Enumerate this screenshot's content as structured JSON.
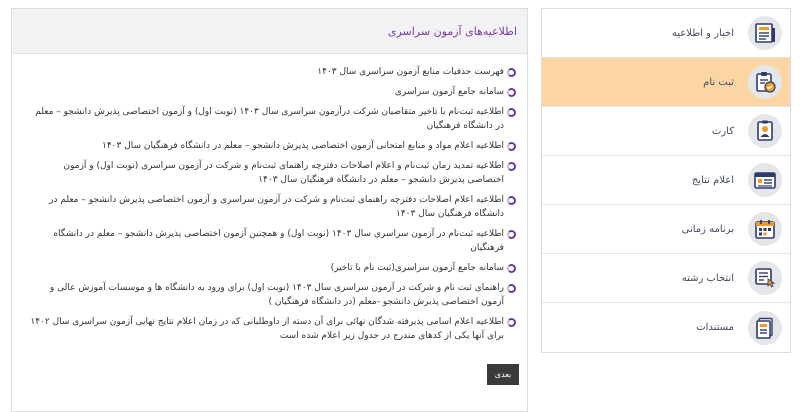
{
  "panel": {
    "title": "اطلاعیه‌های آزمون سراسری",
    "next_label": "بعدی",
    "items": [
      "فهرست حذفیات منابع آزمون سراسری سال ۱۴۰۳",
      "سامانه جامع آزمون سراسری",
      "اطلاعیه ثبت‌نام با تاخیر متقاضیان شرکت درآزمون سراسری سال ۱۴۰۳ (نوبت اول) و آزمون اختصاصی پذیرش دانشجو – معلم در دانشگاه فرهنگیان",
      "اطلاعیه اعلام مواد و منابع امتحانی آزمون اختصاصی پذیرش دانشجو – معلم در دانشگاه فرهنگیان سال ۱۴۰۳",
      "اطلاعیه تمدید زمان ثبت‌نام و اعلام اصلاحات دفترچه راهنمای ثبت‌نام و شرکت در آزمون سراسری (نوبت اول) و آزمون اختصاصی پذیرش دانشجو – معلم در دانشگاه فرهنگیان سال ۱۴۰۳",
      "اطلاعیه اعلام اصلاحات دفترچه راهنمای ثبت‌نام و شرکت در آزمون سراسری و آزمون اختصاصی پذیرش دانشجو – معلم در دانشگاه فرهنگیان سال ۱۴۰۳",
      "اطلاعیه ثبت‌نام در آزمون سراسری  سال ۱۴۰۳ (نوبت اول) و همچنین آزمون اختصاصی پذیرش دانشجو – معلم در دانشگاه فرهنگیان",
      "سامانه جامع آزمون سراسری(ثبت نام با تاخیر)",
      "راهنمای ثبت نام و شرکت در آزمون سراسری سال ۱۴۰۳ (نوبت اول) برای ورود به دانشگاه ها و موسسات آموزش عالی و آزمون اختصاصی پذیرش دانشجو -معلم (در دانشگاه فرهنگیان )",
      "اطلاعیه اعلام اسامی پذیرفته شدگان نهائی برای آن دسته از داوطلبانی که در زمان اعلام نتایج نهایی آزمون سراسری سال ۱۴۰۲ برای آنها یکی از کدهای مندرج در جدول زیر اعلام شده است"
    ]
  },
  "sidebar": {
    "items": [
      {
        "label": "اخبار و اطلاعیه",
        "icon": "news-icon"
      },
      {
        "label": "ثبت نام",
        "icon": "registration-clipboard-icon"
      },
      {
        "label": "کارت",
        "icon": "id-card-icon"
      },
      {
        "label": "اعلام نتایج",
        "icon": "results-icon"
      },
      {
        "label": "برنامه زمانی",
        "icon": "calendar-icon"
      },
      {
        "label": "انتخاب رشته",
        "icon": "field-selection-icon"
      },
      {
        "label": "مستندات",
        "icon": "documents-icon"
      }
    ]
  },
  "colors": {
    "active_item_bg": "#fbd6a4",
    "title_purple": "#7b3aa2",
    "icon_navy": "#2f3b6b",
    "icon_orange": "#f39a25"
  }
}
